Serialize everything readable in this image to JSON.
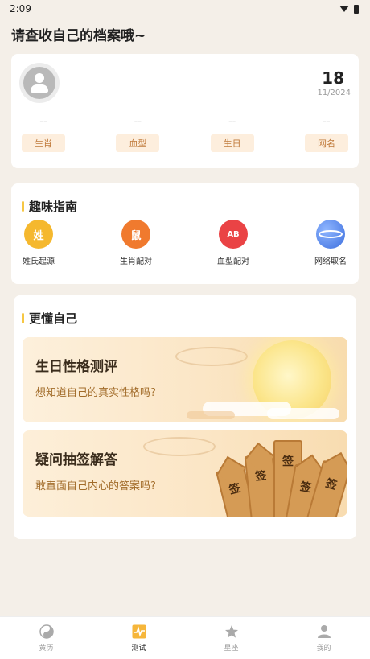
{
  "status_bar": {
    "time": "2:09"
  },
  "page": {
    "title": "请查收自己的档案哦~"
  },
  "profile": {
    "day": "18",
    "month_year": "11/2024",
    "fields": [
      {
        "value": "--",
        "tag": "生肖"
      },
      {
        "value": "--",
        "tag": "血型"
      },
      {
        "value": "--",
        "tag": "生日"
      },
      {
        "value": "--",
        "tag": "网名"
      }
    ]
  },
  "guide": {
    "title": "趣味指南",
    "items": [
      {
        "label": "姓氏起源",
        "icon": "surname-icon",
        "glyph": "姓",
        "color": "#f5b82e"
      },
      {
        "label": "生肖配对",
        "icon": "zodiac-rat-icon",
        "glyph": "鼠",
        "color": "#f07a2e"
      },
      {
        "label": "血型配对",
        "icon": "blood-drop-icon",
        "glyph": "AB",
        "color": "#ea4345"
      },
      {
        "label": "网络取名",
        "icon": "planet-icon",
        "glyph": "",
        "color": "#4f87ea"
      }
    ]
  },
  "know": {
    "title": "更懂自己",
    "banners": [
      {
        "title": "生日性格测评",
        "subtitle": "想知道自己的真实性格吗?"
      },
      {
        "title": "疑问抽签解答",
        "subtitle": "敢直面自己内心的答案吗?",
        "lot_glyph": "签"
      }
    ]
  },
  "tabbar": {
    "tabs": [
      {
        "label": "黄历",
        "icon": "yin-yang-icon"
      },
      {
        "label": "测试",
        "icon": "test-chart-icon"
      },
      {
        "label": "星座",
        "icon": "star-icon"
      },
      {
        "label": "我的",
        "icon": "person-icon"
      }
    ],
    "active": "测试"
  }
}
